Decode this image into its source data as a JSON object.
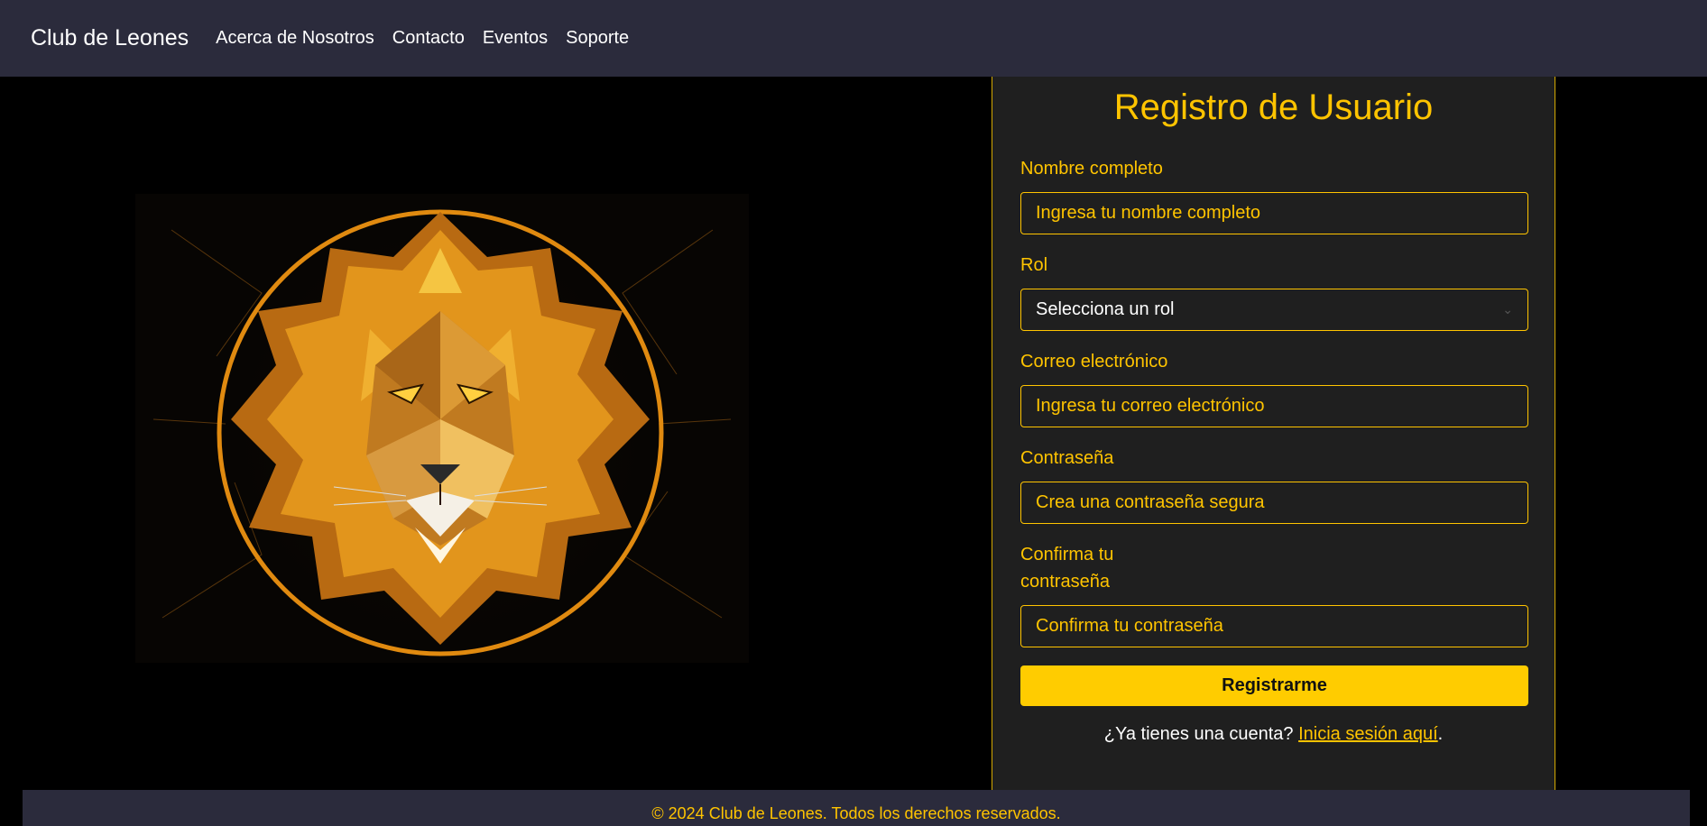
{
  "nav": {
    "brand": "Club de Leones",
    "links": [
      "Acerca de Nosotros",
      "Contacto",
      "Eventos",
      "Soporte"
    ]
  },
  "form": {
    "title": "Registro de Usuario",
    "name_label": "Nombre completo",
    "name_placeholder": "Ingresa tu nombre completo",
    "role_label": "Rol",
    "role_selected": "Selecciona un rol",
    "email_label": "Correo electrónico",
    "email_placeholder": "Ingresa tu correo electrónico",
    "password_label": "Contraseña",
    "password_placeholder": "Crea una contraseña segura",
    "confirm_label_line1": "Confirma tu",
    "confirm_label_line2": "contraseña",
    "confirm_placeholder": "Confirma tu contraseña",
    "submit_label": "Registrarme",
    "login_prompt": "¿Ya tienes una cuenta? ",
    "login_link": "Inicia sesión aquí",
    "login_suffix": "."
  },
  "footer": {
    "text": "© 2024 Club de Leones. Todos los derechos reservados."
  },
  "colors": {
    "accent": "#ffc400",
    "button": "#ffcc00",
    "navbar": "#2b2b3c",
    "panel": "#1f1f1f"
  },
  "icons": {
    "hero": "lion-icon",
    "select": "chevron-down-icon"
  }
}
